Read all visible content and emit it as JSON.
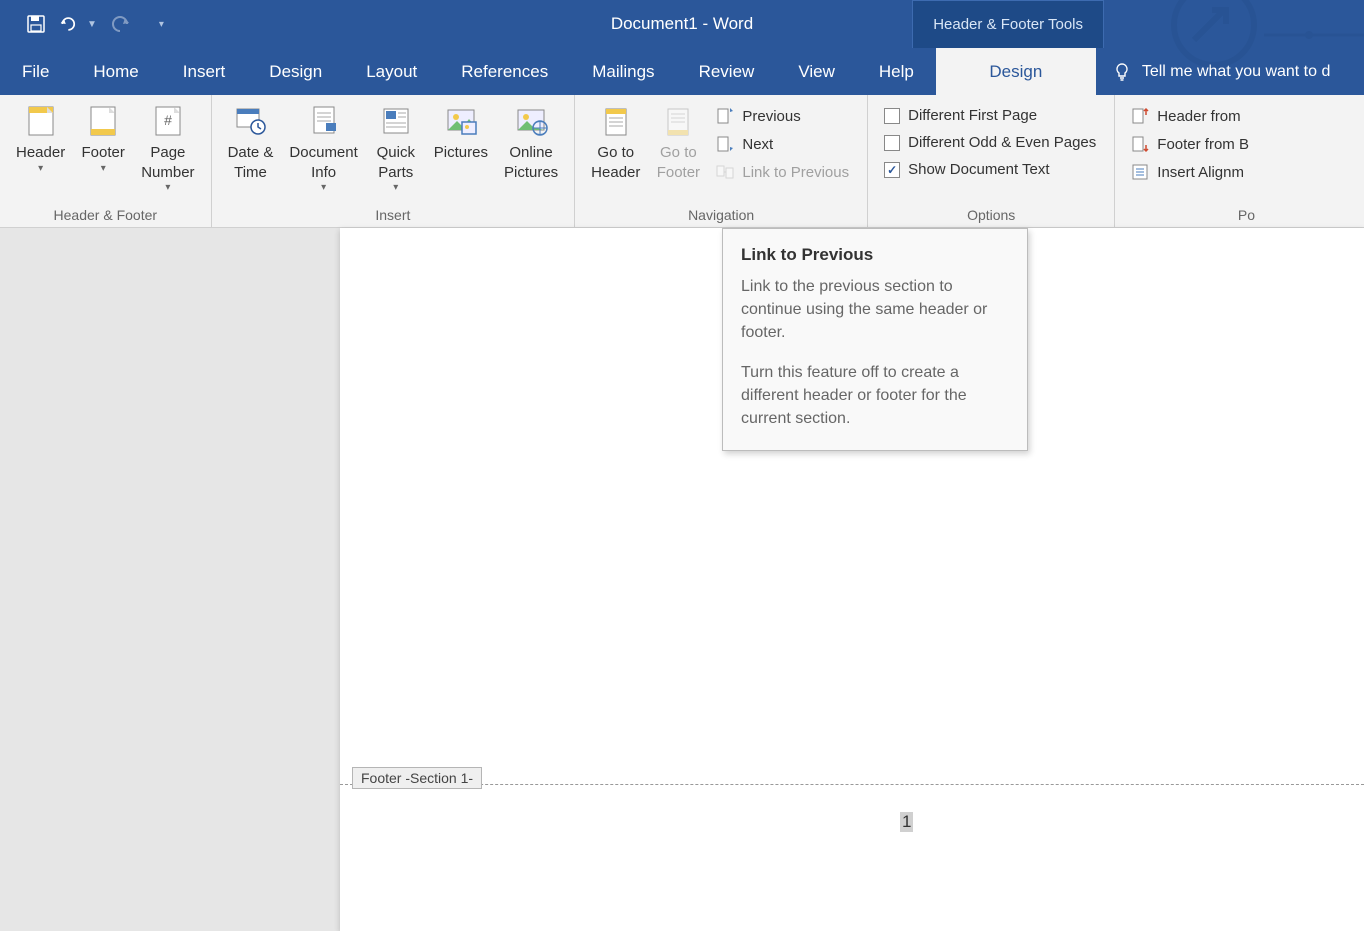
{
  "title": "Document1  -  Word",
  "contextualTab": "Header & Footer Tools",
  "tabs": {
    "file": "File",
    "home": "Home",
    "insert": "Insert",
    "design": "Design",
    "layout": "Layout",
    "references": "References",
    "mailings": "Mailings",
    "review": "Review",
    "view": "View",
    "help": "Help",
    "hfDesign": "Design"
  },
  "tellMe": "Tell me what you want to d",
  "groups": {
    "hf": {
      "label": "Header & Footer",
      "header": "Header",
      "footer": "Footer",
      "pageNumber": "Page\nNumber"
    },
    "insert": {
      "label": "Insert",
      "dateTime": "Date &\nTime",
      "docInfo": "Document\nInfo",
      "quickParts": "Quick\nParts",
      "pictures": "Pictures",
      "onlinePictures": "Online\nPictures"
    },
    "navigation": {
      "label": "Navigation",
      "goToHeader": "Go to\nHeader",
      "goToFooter": "Go to\nFooter",
      "previous": "Previous",
      "next": "Next",
      "linkPrev": "Link to Previous"
    },
    "options": {
      "label": "Options",
      "diffFirst": "Different First Page",
      "diffOdd": "Different Odd & Even Pages",
      "showDoc": "Show Document Text"
    },
    "position": {
      "label": "Po",
      "headerFrom": "Header from ",
      "footerFrom": "Footer from B",
      "insertAlign": "Insert Alignm"
    }
  },
  "tooltip": {
    "title": "Link to Previous",
    "p1": "Link to the previous section to continue using the same header or footer.",
    "p2": "Turn this feature off to create a different header or footer for the current section."
  },
  "footerTag": "Footer -Section 1-",
  "pageNum": "1"
}
